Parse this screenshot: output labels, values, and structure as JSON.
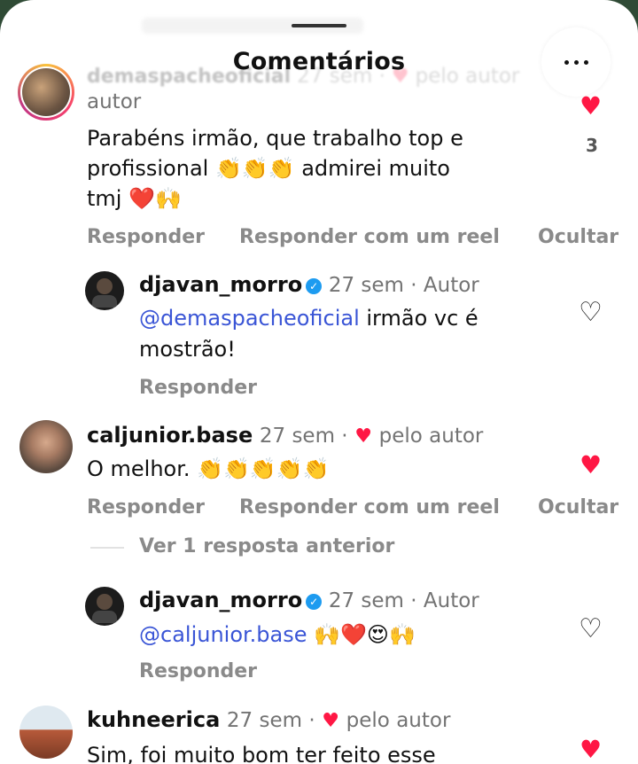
{
  "sheet": {
    "title": "Comentários",
    "more_icon": "more-horizontal-icon"
  },
  "comment1": {
    "username": "demaspacheoficial",
    "time": "27 sem ·",
    "liked_by": "pelo autor",
    "liked_by_2": "autor",
    "text_line1": "Parabéns irmão, que trabalho top e",
    "text_line2": "profissional 👏👏👏 admirei muito",
    "text_line3": "tmj ❤️🙌",
    "likes": "3",
    "reply": "Responder",
    "reply_reel": "Responder com um reel",
    "hide": "Ocultar"
  },
  "reply1": {
    "username": "djavan_morro",
    "time": "27 sem · Autor",
    "mention": "@demaspacheoficial",
    "text_rest": "irmão vc é",
    "text_line2": "mostrão!",
    "reply": "Responder"
  },
  "comment2": {
    "username": "caljunior.base",
    "time": "27 sem ·",
    "liked_by": "pelo autor",
    "text": "O melhor. 👏👏👏👏👏",
    "reply": "Responder",
    "reply_reel": "Responder com um reel",
    "hide": "Ocultar",
    "view_previous": "Ver 1 resposta anterior"
  },
  "reply2": {
    "username": "djavan_morro",
    "time": "27 sem · Autor",
    "mention": "@caljunior.base",
    "text_rest": "🙌❤️😍🙌",
    "reply": "Responder"
  },
  "comment3": {
    "username": "kuhneerica",
    "time": "27 sem ·",
    "liked_by": "pelo autor",
    "text_partial": "Sim, foi muito bom ter feito esse"
  },
  "colors": {
    "heart": "#ff1744",
    "mention": "#3a55d6",
    "meta": "#737373"
  }
}
